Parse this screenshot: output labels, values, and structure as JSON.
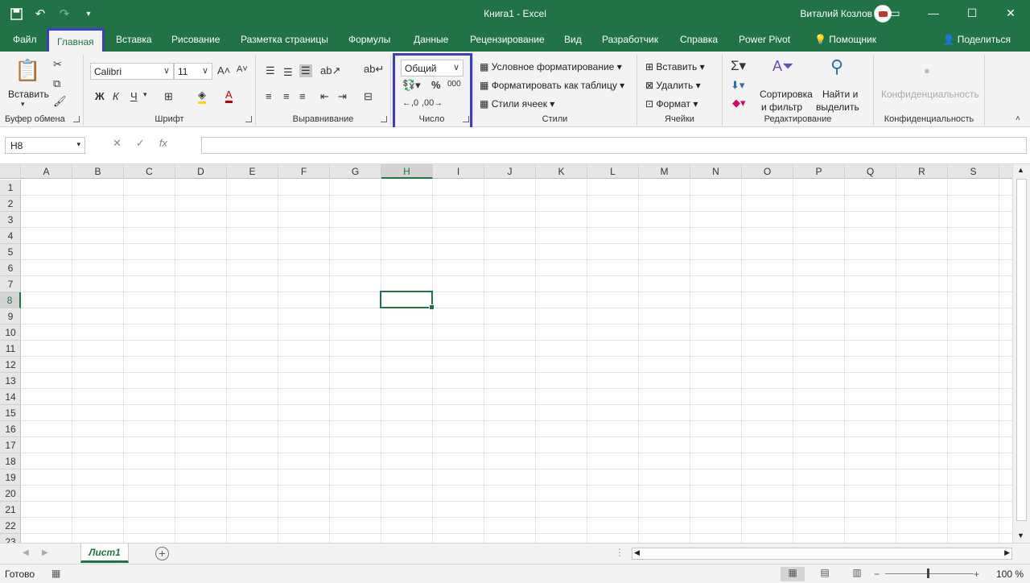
{
  "titlebar": {
    "title": "Книга1  -  Excel",
    "user": "Виталий Козлов"
  },
  "tabs": [
    "Файл",
    "Главная",
    "Вставка",
    "Рисование",
    "Разметка страницы",
    "Формулы",
    "Данные",
    "Рецензирование",
    "Вид",
    "Разработчик",
    "Справка",
    "Power Pivot",
    "Помощник"
  ],
  "share": "Поделиться",
  "clipboard": {
    "paste": "Вставить",
    "label": "Буфер обмена"
  },
  "font": {
    "name": "Calibri",
    "size": "11",
    "bold": "Ж",
    "italic": "К",
    "underline": "Ч",
    "label": "Шрифт"
  },
  "alignment": {
    "label": "Выравнивание"
  },
  "number": {
    "format": "Общий",
    "percent": "%",
    "thousands": "000",
    "label": "Число"
  },
  "styles": {
    "conditional": "Условное форматирование",
    "table": "Форматировать как таблицу",
    "cell": "Стили ячеек",
    "label": "Стили"
  },
  "cells_group": {
    "insert": "Вставить",
    "delete": "Удалить",
    "format": "Формат",
    "label": "Ячейки"
  },
  "editing": {
    "sort1": "Сортировка",
    "sort2": "и фильтр",
    "find1": "Найти и",
    "find2": "выделить",
    "label": "Редактирование"
  },
  "privacy": {
    "name": "Конфиденциальность",
    "label": "Конфиденциальность"
  },
  "namebox": "H8",
  "columns": [
    "A",
    "B",
    "C",
    "D",
    "E",
    "F",
    "G",
    "H",
    "I",
    "J",
    "K",
    "L",
    "M",
    "N",
    "O",
    "P",
    "Q",
    "R",
    "S"
  ],
  "selected_column": "H",
  "rows": [
    "1",
    "2",
    "3",
    "4",
    "5",
    "6",
    "7",
    "8",
    "9",
    "10",
    "11",
    "12",
    "13",
    "14",
    "15",
    "16",
    "17",
    "18",
    "19",
    "20",
    "21",
    "22",
    "23"
  ],
  "selected_row": "8",
  "sheet": "Лист1",
  "status": "Готово",
  "zoom": "100 %"
}
